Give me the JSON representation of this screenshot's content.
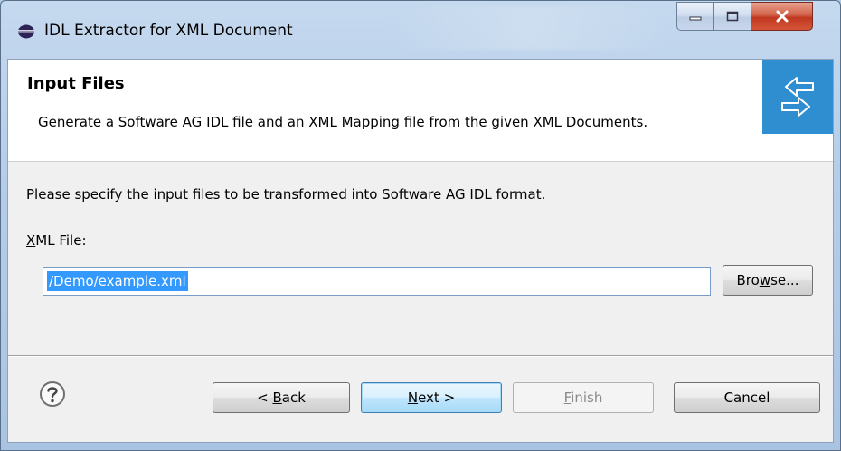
{
  "window": {
    "title": "IDL Extractor for XML Document"
  },
  "header": {
    "title": "Input Files",
    "description": "Generate a Software AG IDL file and an XML Mapping file from the given XML Documents."
  },
  "body": {
    "instruction": "Please specify the input files to be transformed into Software AG IDL format.",
    "xml_file_label": {
      "mnemonic": "X",
      "rest": "ML File:"
    },
    "xml_file_value": "/Demo/example.xml",
    "browse": {
      "pre": "Bro",
      "mnemonic": "w",
      "post": "se..."
    }
  },
  "footer": {
    "back": {
      "pre": "< ",
      "mnemonic": "B",
      "post": "ack"
    },
    "next": {
      "mnemonic": "N",
      "post": "ext >"
    },
    "finish": {
      "mnemonic": "F",
      "post": "inish"
    },
    "cancel": "Cancel"
  },
  "icons": {
    "app": "eclipse-icon",
    "banner": "exchange-arrows-icon",
    "help": "help-icon",
    "minimize": "minimize-icon",
    "maximize": "maximize-icon",
    "close": "close-icon"
  },
  "colors": {
    "banner": "#2e8ed0",
    "selection": "#3399ff",
    "close_button": "#c0391f"
  }
}
